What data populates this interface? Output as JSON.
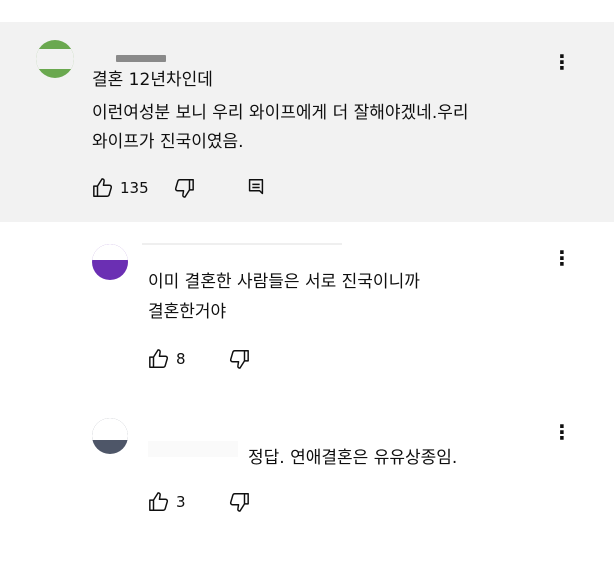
{
  "comments": [
    {
      "text_lines": [
        "결혼 12년차인데",
        "이런여성분 보니 우리 와이프에게 더 잘해야겠네.우리",
        "와이프가 진국이였음."
      ],
      "likes": "135",
      "menu_glyph": "⋮"
    },
    {
      "text_lines": [
        "이미 결혼한 사람들은 서로 진국이니까",
        "결혼한거야"
      ],
      "likes": "8",
      "menu_glyph": "⋮"
    },
    {
      "text_lines": [
        "정답. 연애결혼은 유유상종임."
      ],
      "likes": "3",
      "menu_glyph": "⋮"
    }
  ],
  "icons": {
    "like": "thumb-up-icon",
    "dislike": "thumb-down-icon",
    "reply": "reply-icon",
    "menu": "more-vert-icon"
  },
  "colors": {
    "highlight_bg": "#f2f2f2",
    "text": "#0f0f0f"
  }
}
